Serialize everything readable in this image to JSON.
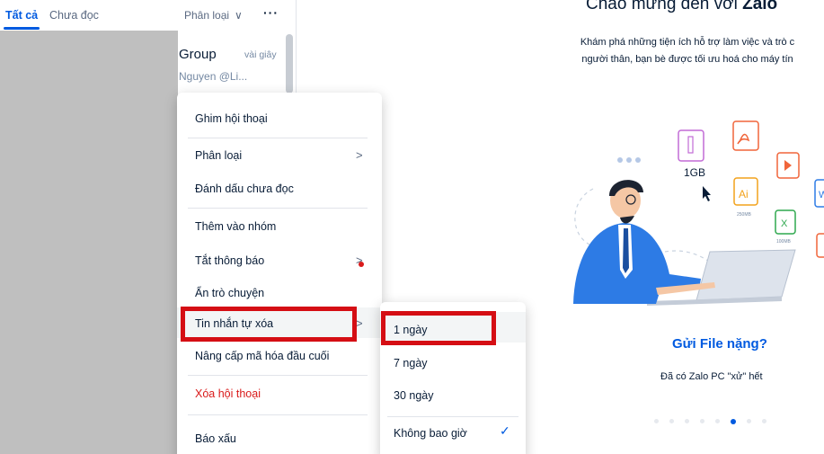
{
  "tabs": {
    "all": "Tất cả",
    "unread": "Chưa đọc",
    "classify": "Phân loại",
    "classify_chevron": "∨",
    "more": "···"
  },
  "conversation": {
    "name": "Group",
    "time": "vài giây",
    "preview": "Nguyen @Li..."
  },
  "fragments": {
    "a": "I",
    "b": "2",
    "c": "r",
    "d": "i"
  },
  "welcome": {
    "title_prefix": "Chào mừng đến với ",
    "title_brand": "Zalo",
    "desc_line1": "Khám phá những tiện ích hỗ trợ làm việc và trò c",
    "desc_line2": "người thân, bạn bè được tối ưu hoá cho máy tín",
    "feature_title": "Gửi File nặng?",
    "feature_desc": "Đã có Zalo PC \"xử\" hết",
    "illustration_labels": {
      "size": "1GB",
      "ai": "Ai",
      "ai_size": "250MB",
      "excel": "X",
      "excel_size": "100MB",
      "word": "W"
    }
  },
  "context_menu": {
    "items": [
      {
        "label": "Ghim hội thoại"
      },
      {
        "label": "Phân loại",
        "chevron": ">"
      },
      {
        "label": "Đánh dấu chưa đọc"
      },
      {
        "label": "Thêm vào nhóm"
      },
      {
        "label": "Tắt thông báo",
        "chevron": ">"
      },
      {
        "label": "Ẩn trò chuyện"
      },
      {
        "label": "Tin nhắn tự xóa",
        "chevron": ">"
      },
      {
        "label": "Nâng cấp mã hóa đầu cuối"
      },
      {
        "label": "Xóa hội thoại"
      },
      {
        "label": "Báo xấu"
      }
    ]
  },
  "submenu": {
    "items": [
      {
        "label": "1 ngày"
      },
      {
        "label": "7 ngày"
      },
      {
        "label": "30 ngày"
      },
      {
        "label": "Không bao giờ",
        "check": "✓"
      }
    ]
  },
  "colors": {
    "accent": "#005ae0",
    "danger": "#d91b1b",
    "annotation": "#d50e14"
  }
}
